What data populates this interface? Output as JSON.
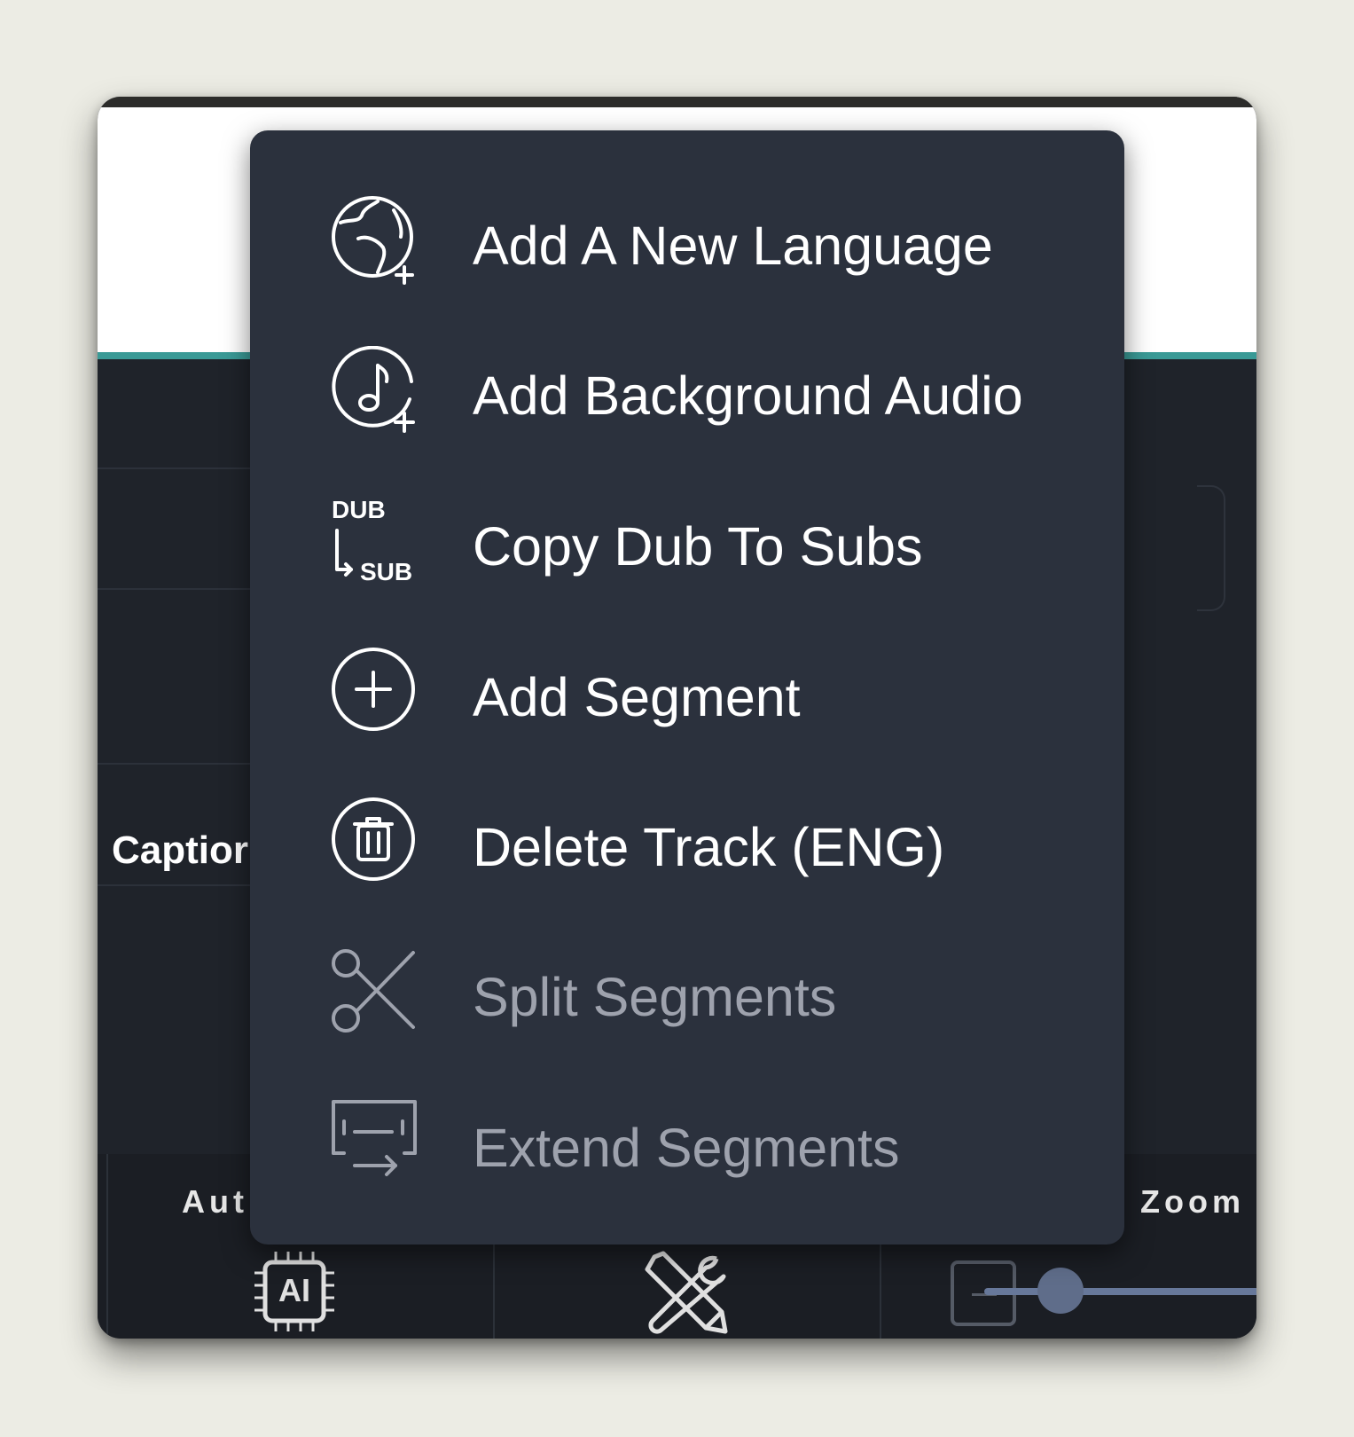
{
  "background_panel": {
    "caption_label": "Captior",
    "bottom_labels": {
      "auto": "Aut",
      "zoom": "Zoom"
    },
    "ai_button_label": "AI"
  },
  "context_menu": {
    "items": [
      {
        "label": "Add A New Language",
        "icon": "globe-add-icon",
        "enabled": true
      },
      {
        "label": "Add Background Audio",
        "icon": "music-note-add-icon",
        "enabled": true
      },
      {
        "label": "Copy Dub To Subs",
        "icon": "dub-to-sub-icon",
        "icon_text_top": "DUB",
        "icon_text_bottom": "SUB",
        "enabled": true
      },
      {
        "label": "Add Segment",
        "icon": "plus-circle-icon",
        "enabled": true
      },
      {
        "label": "Delete Track (ENG)",
        "icon": "trash-circle-icon",
        "enabled": true
      },
      {
        "label": "Split Segments",
        "icon": "scissors-icon",
        "enabled": false
      },
      {
        "label": "Extend Segments",
        "icon": "extend-segments-icon",
        "enabled": false
      }
    ]
  },
  "colors": {
    "menu_bg": "#2b313d",
    "accent_teal": "#3a9a96",
    "disabled_text": "#9ea2ad"
  }
}
